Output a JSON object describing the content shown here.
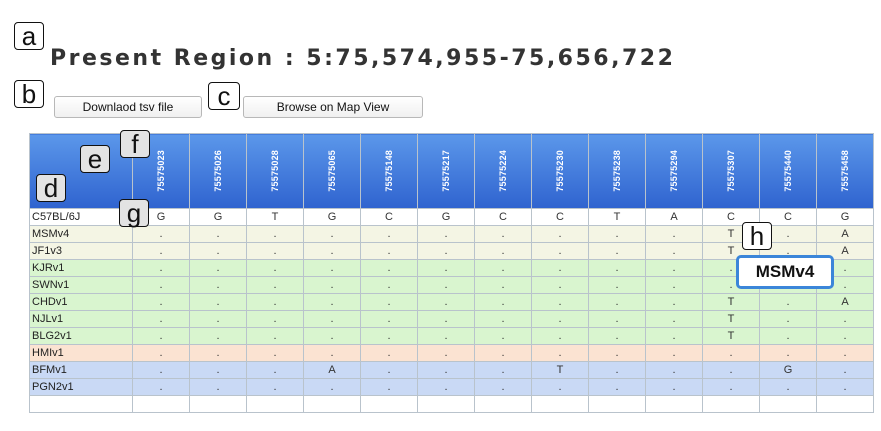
{
  "page_title": "Present Region : 5:75,574,955-75,656,722",
  "buttons": {
    "download": "Downlaod tsv file",
    "browse": "Browse on Map View"
  },
  "labels": {
    "a": "a",
    "b": "b",
    "c": "c",
    "d": "d",
    "e": "e",
    "f": "f",
    "g": "g",
    "h": "h"
  },
  "tooltip": "MSMv4",
  "positions": [
    "75575023",
    "75575026",
    "75575028",
    "75575065",
    "75575148",
    "75575217",
    "75575224",
    "75575230",
    "75575238",
    "75575294",
    "75575307",
    "75575440",
    "75575458"
  ],
  "rows": [
    {
      "strain": "C57BL/6J",
      "group": "ref",
      "cells": [
        "G",
        "G",
        "T",
        "G",
        "C",
        "G",
        "C",
        "C",
        "T",
        "A",
        "C",
        "C",
        "G"
      ]
    },
    {
      "strain": "MSMv4",
      "group": "g-beige",
      "cells": [
        ".",
        ".",
        ".",
        ".",
        ".",
        ".",
        ".",
        ".",
        ".",
        ".",
        "T",
        ".",
        "A"
      ]
    },
    {
      "strain": "JF1v3",
      "group": "g-beige",
      "cells": [
        ".",
        ".",
        ".",
        ".",
        ".",
        ".",
        ".",
        ".",
        ".",
        ".",
        "T",
        ".",
        "A"
      ]
    },
    {
      "strain": "KJRv1",
      "group": "g-green",
      "cells": [
        ".",
        ".",
        ".",
        ".",
        ".",
        ".",
        ".",
        ".",
        ".",
        ".",
        ".",
        ".",
        "."
      ]
    },
    {
      "strain": "SWNv1",
      "group": "g-green",
      "cells": [
        ".",
        ".",
        ".",
        ".",
        ".",
        ".",
        ".",
        ".",
        ".",
        ".",
        ".",
        ".",
        "."
      ]
    },
    {
      "strain": "CHDv1",
      "group": "g-green",
      "cells": [
        ".",
        ".",
        ".",
        ".",
        ".",
        ".",
        ".",
        ".",
        ".",
        ".",
        "T",
        ".",
        "A"
      ]
    },
    {
      "strain": "NJLv1",
      "group": "g-green",
      "cells": [
        ".",
        ".",
        ".",
        ".",
        ".",
        ".",
        ".",
        ".",
        ".",
        ".",
        "T",
        ".",
        "."
      ]
    },
    {
      "strain": "BLG2v1",
      "group": "g-green",
      "cells": [
        ".",
        ".",
        ".",
        ".",
        ".",
        ".",
        ".",
        ".",
        ".",
        ".",
        "T",
        ".",
        "."
      ]
    },
    {
      "strain": "HMIv1",
      "group": "g-peach",
      "cells": [
        ".",
        ".",
        ".",
        ".",
        ".",
        ".",
        ".",
        ".",
        ".",
        ".",
        ".",
        ".",
        "."
      ]
    },
    {
      "strain": "BFMv1",
      "group": "g-blue",
      "cells": [
        ".",
        ".",
        ".",
        "A",
        ".",
        ".",
        ".",
        "T",
        ".",
        ".",
        ".",
        "G",
        "."
      ]
    },
    {
      "strain": "PGN2v1",
      "group": "g-blue",
      "cells": [
        ".",
        ".",
        ".",
        ".",
        ".",
        ".",
        ".",
        ".",
        ".",
        ".",
        ".",
        ".",
        "."
      ]
    },
    {
      "strain": "",
      "group": "ref",
      "cells": [
        "",
        "",
        "",
        "",
        "",
        "",
        "",
        "",
        "",
        "",
        "",
        "",
        ""
      ]
    }
  ]
}
